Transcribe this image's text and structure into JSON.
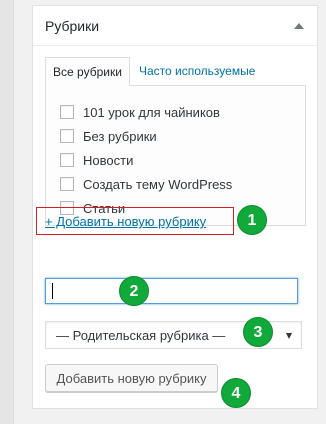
{
  "panel": {
    "title": "Рубрики",
    "toggle_icon": "triangle-up-icon"
  },
  "tabs": [
    {
      "label": "Все рубрики",
      "active": true
    },
    {
      "label": "Часто используемые",
      "active": false
    }
  ],
  "categories": [
    {
      "label": "101 урок для чайников",
      "checked": false
    },
    {
      "label": "Без рубрики",
      "checked": false
    },
    {
      "label": "Новости",
      "checked": false
    },
    {
      "label": "Создать тему WordPress",
      "checked": false
    },
    {
      "label": "Статьи",
      "checked": false
    }
  ],
  "add_new": {
    "link_label": "+ Добавить новую рубрику",
    "name_value": "",
    "parent_selected": "— Родительская рубрика —",
    "button_label": "Добавить новую рубрику"
  },
  "annotations": [
    "1",
    "2",
    "3",
    "4"
  ],
  "colors": {
    "link": "#0073aa",
    "highlight_border": "#d51f27",
    "badge": "#10a93a",
    "focus_border": "#5b9dd9"
  }
}
